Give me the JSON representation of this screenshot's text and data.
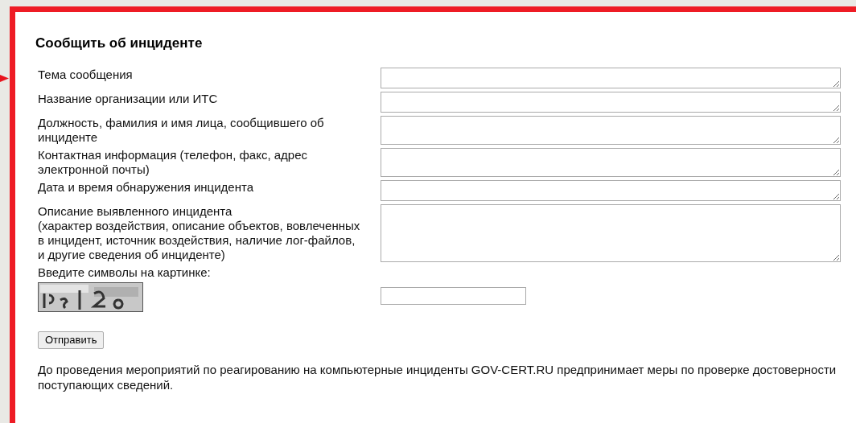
{
  "title": "Сообщить об инциденте",
  "fields": [
    {
      "label": "Тема сообщения",
      "kind": "textarea"
    },
    {
      "label": "Название организации или ИТС",
      "kind": "textarea"
    },
    {
      "label": "Должность, фамилия и имя лица, сообщившего об инциденте",
      "kind": "textarea"
    },
    {
      "label": "Контактная информация (телефон, факс, адрес электронной почты)",
      "kind": "textarea"
    },
    {
      "label": "Дата и время обнаружения инцидента",
      "kind": "textarea"
    },
    {
      "label": "Описание выявленного инцидента\n(характер воздействия, описание объектов, вовлеченных в инцидент, источник воздействия, наличие лог-файлов, и другие сведения об инциденте)",
      "kind": "textarea"
    }
  ],
  "captcha": {
    "label": "Введите символы на картинке:"
  },
  "submit": "Отправить",
  "note": "До проведения мероприятий по реагированию на компьютерные инциденты GOV-CERT.RU предпринимает меры по проверке достоверности поступающих сведений."
}
